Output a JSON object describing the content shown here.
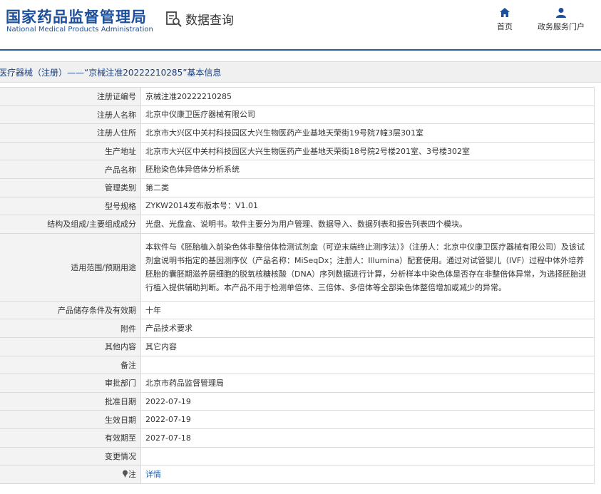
{
  "header": {
    "logo_cn": "国家药品监督管理局",
    "logo_en": "National Medical Products Administration",
    "search_title": "数据查询",
    "nav_home": "首页",
    "nav_portal": "政务服务门户"
  },
  "title_bar": "医疗器械（注册）——“京械注准20222210285”基本信息",
  "rows": [
    {
      "label": "注册证编号",
      "value": "京械注准20222210285"
    },
    {
      "label": "注册人名称",
      "value": "北京中仪康卫医疗器械有限公司"
    },
    {
      "label": "注册人住所",
      "value": "北京市大兴区中关村科技园区大兴生物医药产业基地天荣街19号院7幢3层301室"
    },
    {
      "label": "生产地址",
      "value": "北京市大兴区中关村科技园区大兴生物医药产业基地天荣街18号院2号楼201室、3号楼302室"
    },
    {
      "label": "产品名称",
      "value": "胚胎染色体异倍体分析系统"
    },
    {
      "label": "管理类别",
      "value": "第二类"
    },
    {
      "label": "型号规格",
      "value": "ZYKW2014发布版本号：V1.01"
    },
    {
      "label": "结构及组成/主要组成成分",
      "value": "光盘、光盘盒、说明书。软件主要分为用户管理、数据导入、数据列表和报告列表四个模块。"
    },
    {
      "label": "适用范围/预期用途",
      "value": "本软件与《胚胎植入前染色体非整倍体检测试剂盒（可逆末端终止测序法）》（注册人：北京中仪康卫医疗器械有限公司）及该试剂盒说明书指定的基因测序仪（产品名称：MiSeqDx；注册人：Illumina）配套使用。通过对试管婴儿（IVF）过程中体外培养胚胎的囊胚期滋养层细胞的脱氧核糖核酸（DNA）序列数据进行计算，分析样本中染色体是否存在非整倍体异常，为选择胚胎进行植入提供辅助判断。本产品不用于检测单倍体、三倍体、多倍体等全部染色体整倍增加或减少的异常。"
    },
    {
      "label": "产品储存条件及有效期",
      "value": "十年"
    },
    {
      "label": "附件",
      "value": "产品技术要求"
    },
    {
      "label": "其他内容",
      "value": "其它内容"
    },
    {
      "label": "备注",
      "value": ""
    },
    {
      "label": "审批部门",
      "value": "北京市药品监督管理局"
    },
    {
      "label": "批准日期",
      "value": "2022-07-19"
    },
    {
      "label": "生效日期",
      "value": "2022-07-19"
    },
    {
      "label": "有效期至",
      "value": "2027-07-18"
    },
    {
      "label": "变更情况",
      "value": ""
    }
  ],
  "note_row": {
    "label": "注",
    "link": "详情"
  },
  "colors": {
    "brand": "#1c4f9c",
    "link": "#1c62b9",
    "label_bg": "#f3f3f3"
  },
  "icons": [
    "search-document-icon",
    "home-icon",
    "user-icon",
    "info-pin-icon"
  ]
}
